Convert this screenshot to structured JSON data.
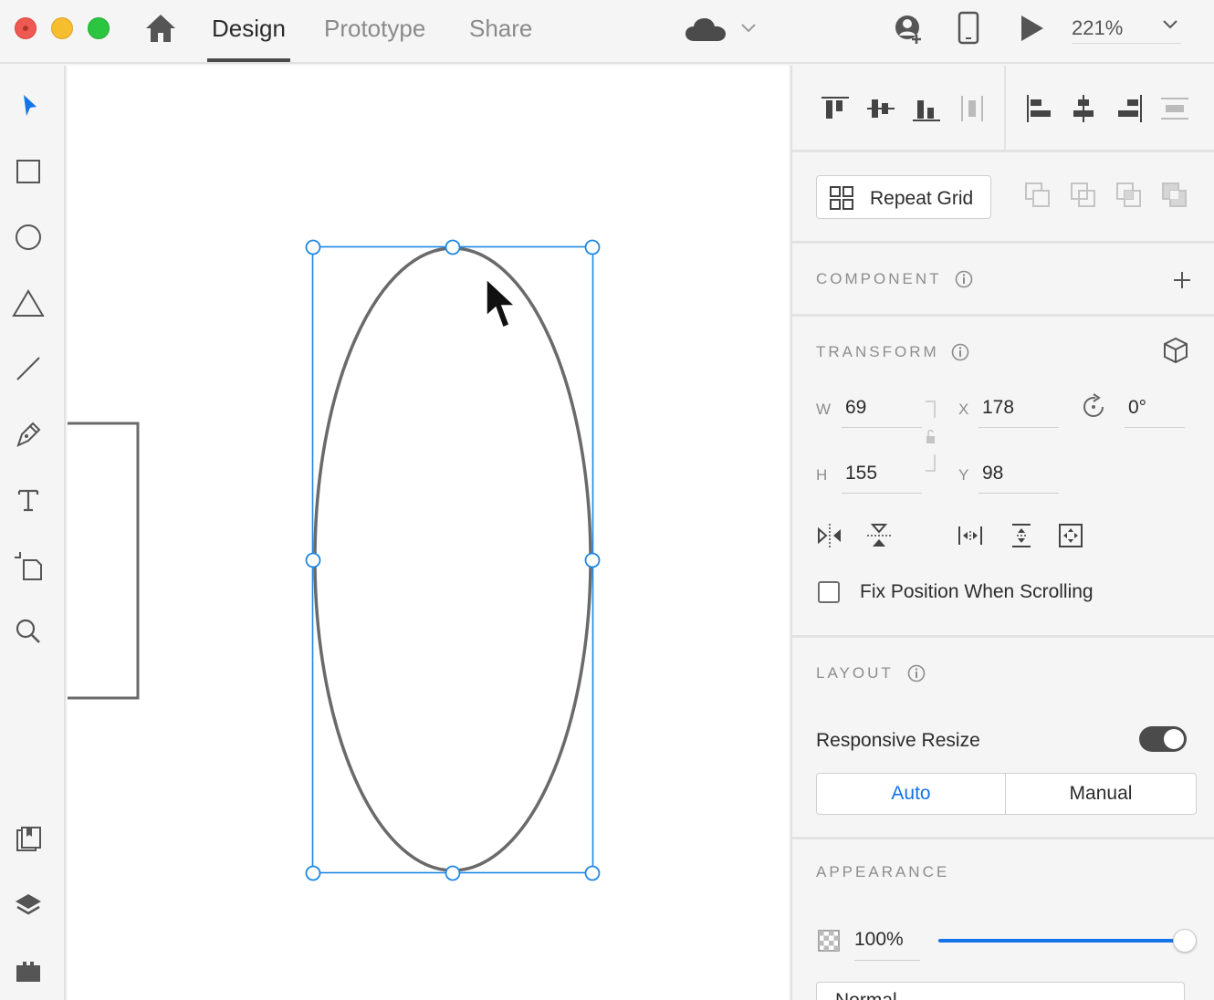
{
  "header": {
    "tabs": [
      {
        "label": "Design",
        "active": true
      },
      {
        "label": "Prototype",
        "active": false
      },
      {
        "label": "Share",
        "active": false
      }
    ],
    "zoom": "221%"
  },
  "toolbar": {
    "tools": [
      "select-tool",
      "rectangle-tool",
      "ellipse-tool",
      "polygon-tool",
      "line-tool",
      "pen-tool",
      "text-tool",
      "artboard-tool",
      "zoom-tool"
    ],
    "bottom_tools": [
      "assets-panel",
      "layers-panel",
      "plugins-panel"
    ]
  },
  "panel": {
    "repeat_grid_label": "Repeat Grid",
    "component": {
      "title": "COMPONENT"
    },
    "transform": {
      "title": "TRANSFORM",
      "w_label": "W",
      "w_value": "69",
      "h_label": "H",
      "h_value": "155",
      "x_label": "X",
      "x_value": "178",
      "y_label": "Y",
      "y_value": "98",
      "rotation": "0°",
      "fix_position_label": "Fix Position When Scrolling",
      "fix_position_checked": false
    },
    "layout": {
      "title": "LAYOUT",
      "responsive_label": "Responsive Resize",
      "responsive_on": true,
      "auto_label": "Auto",
      "manual_label": "Manual",
      "selected": "Auto"
    },
    "appearance": {
      "title": "APPEARANCE",
      "opacity": "100%",
      "opacity_fraction": 1.0,
      "blend_mode": "Normal"
    }
  },
  "colors": {
    "accent": "#1473e6",
    "selection": "#1e88e5",
    "shape_stroke": "#6a6a6a"
  }
}
